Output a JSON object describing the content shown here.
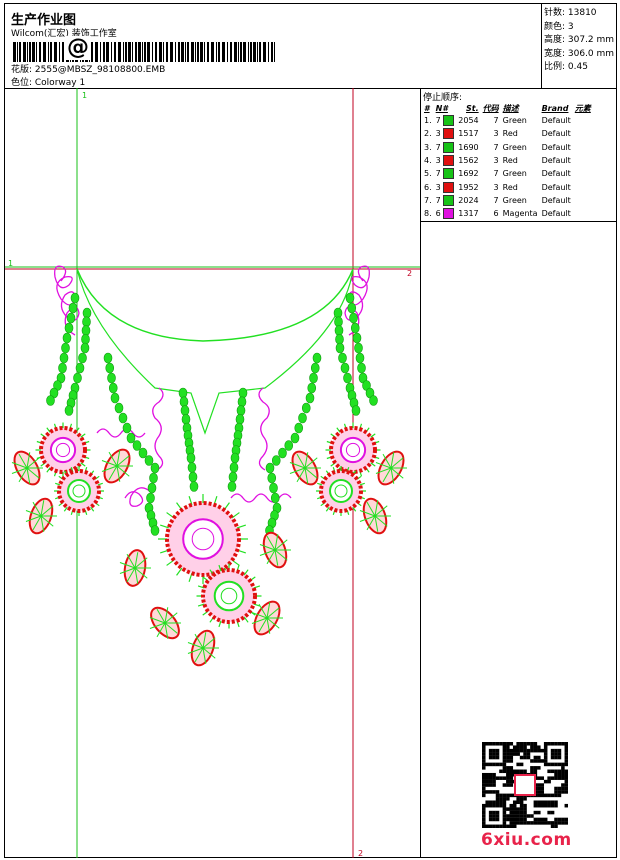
{
  "header": {
    "title": "生产作业图",
    "company": "Wilcom(汇宏) 装饰工作室",
    "barcode_text": "@",
    "design_label": "花版: 2555@MBSZ_98108800.EMB",
    "colorway_label": "色位: Colorway 1"
  },
  "stats": {
    "stitches": "针数: 13810",
    "colors": "颜色: 3",
    "height": "高度: 307.2 mm",
    "width": "宽度: 306.0 mm",
    "scale": "比例: 0.45"
  },
  "stop_sequence": {
    "title": "停止顺序:",
    "headers": [
      "#",
      "N#",
      "St.",
      "代码",
      "描述",
      "Brand",
      "元素"
    ],
    "rows": [
      {
        "num": "1.",
        "needle": "7",
        "stitches": "2054",
        "code": "7",
        "desc": "Green",
        "brand": "Default",
        "color": "#17c317"
      },
      {
        "num": "2.",
        "needle": "3",
        "stitches": "1517",
        "code": "3",
        "desc": "Red",
        "brand": "Default",
        "color": "#e01010"
      },
      {
        "num": "3.",
        "needle": "7",
        "stitches": "1690",
        "code": "7",
        "desc": "Green",
        "brand": "Default",
        "color": "#17c317"
      },
      {
        "num": "4.",
        "needle": "3",
        "stitches": "1562",
        "code": "3",
        "desc": "Red",
        "brand": "Default",
        "color": "#e01010"
      },
      {
        "num": "5.",
        "needle": "7",
        "stitches": "1692",
        "code": "7",
        "desc": "Green",
        "brand": "Default",
        "color": "#17c317"
      },
      {
        "num": "6.",
        "needle": "3",
        "stitches": "1952",
        "code": "3",
        "desc": "Red",
        "brand": "Default",
        "color": "#e01010"
      },
      {
        "num": "7.",
        "needle": "7",
        "stitches": "2024",
        "code": "7",
        "desc": "Green",
        "brand": "Default",
        "color": "#17c317"
      },
      {
        "num": "8.",
        "needle": "6",
        "stitches": "1317",
        "code": "6",
        "desc": "Magenta",
        "brand": "Default",
        "color": "#e010e0"
      }
    ]
  },
  "guides": {
    "v1": "1",
    "h1": "1",
    "h2": "2",
    "v2": "2"
  },
  "watermark": "6xiu.com",
  "palette": {
    "green": "#22e022",
    "red": "#e01010",
    "magenta": "#e010e0",
    "guide_green": "#18c018",
    "guide_red": "#c00020"
  }
}
